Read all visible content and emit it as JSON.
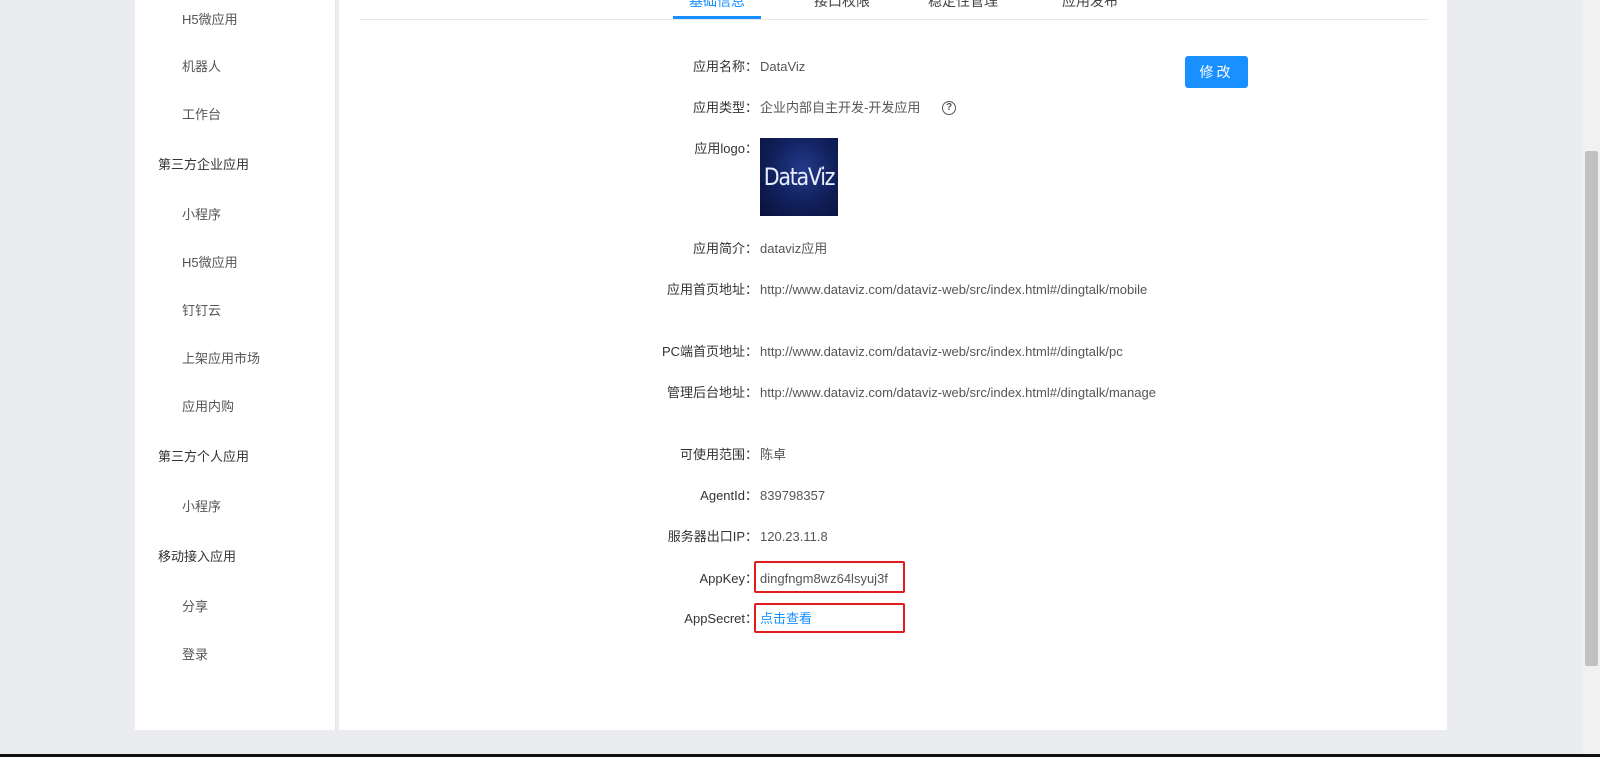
{
  "sidebar": {
    "items": [
      {
        "label": "H5微应用",
        "kind": "sub"
      },
      {
        "label": "机器人",
        "kind": "sub"
      },
      {
        "label": "工作台",
        "kind": "sub"
      },
      {
        "label": "第三方企业应用",
        "kind": "group"
      },
      {
        "label": "小程序",
        "kind": "sub"
      },
      {
        "label": "H5微应用",
        "kind": "sub"
      },
      {
        "label": "钉钉云",
        "kind": "sub"
      },
      {
        "label": "上架应用市场",
        "kind": "sub"
      },
      {
        "label": "应用内购",
        "kind": "sub"
      },
      {
        "label": "第三方个人应用",
        "kind": "group"
      },
      {
        "label": "小程序",
        "kind": "sub"
      },
      {
        "label": "移动接入应用",
        "kind": "group"
      },
      {
        "label": "分享",
        "kind": "sub"
      },
      {
        "label": "登录",
        "kind": "sub"
      }
    ]
  },
  "tabs": [
    {
      "label": "基础信息",
      "active": true
    },
    {
      "label": "接口权限",
      "active": false
    },
    {
      "label": "稳定性管理",
      "active": false
    },
    {
      "label": "应用发布",
      "active": false
    }
  ],
  "edit_button": {
    "label": "修改"
  },
  "fields": {
    "app_name": {
      "label": "应用名称：",
      "value": "DataViz"
    },
    "app_type": {
      "label": "应用类型：",
      "value": "企业内部自主开发-开发应用",
      "help_icon": "question-circle-icon"
    },
    "app_logo": {
      "label": "应用logo：",
      "logo_text": "DataViz"
    },
    "app_intro": {
      "label": "应用简介：",
      "value": "dataviz应用"
    },
    "home_url": {
      "label": "应用首页地址：",
      "value": "http://www.dataviz.com/dataviz-web/src/index.html#/dingtalk/mobile"
    },
    "pc_url": {
      "label": "PC端首页地址：",
      "value": "http://www.dataviz.com/dataviz-web/src/index.html#/dingtalk/pc"
    },
    "admin_url": {
      "label": "管理后台地址：",
      "value": "http://www.dataviz.com/dataviz-web/src/index.html#/dingtalk/manage"
    },
    "scope": {
      "label": "可使用范围：",
      "value": "陈卓"
    },
    "agent_id": {
      "label": "AgentId：",
      "value": "839798357"
    },
    "server_ip": {
      "label": "服务器出口IP：",
      "value": "120.23.11.8"
    },
    "app_key": {
      "label": "AppKey：",
      "value": "dingfngm8wz64lsyuj3f"
    },
    "app_secret": {
      "label": "AppSecret：",
      "value": "点击查看"
    }
  },
  "colors": {
    "accent": "#1890ff",
    "highlight": "#e21b1b"
  }
}
